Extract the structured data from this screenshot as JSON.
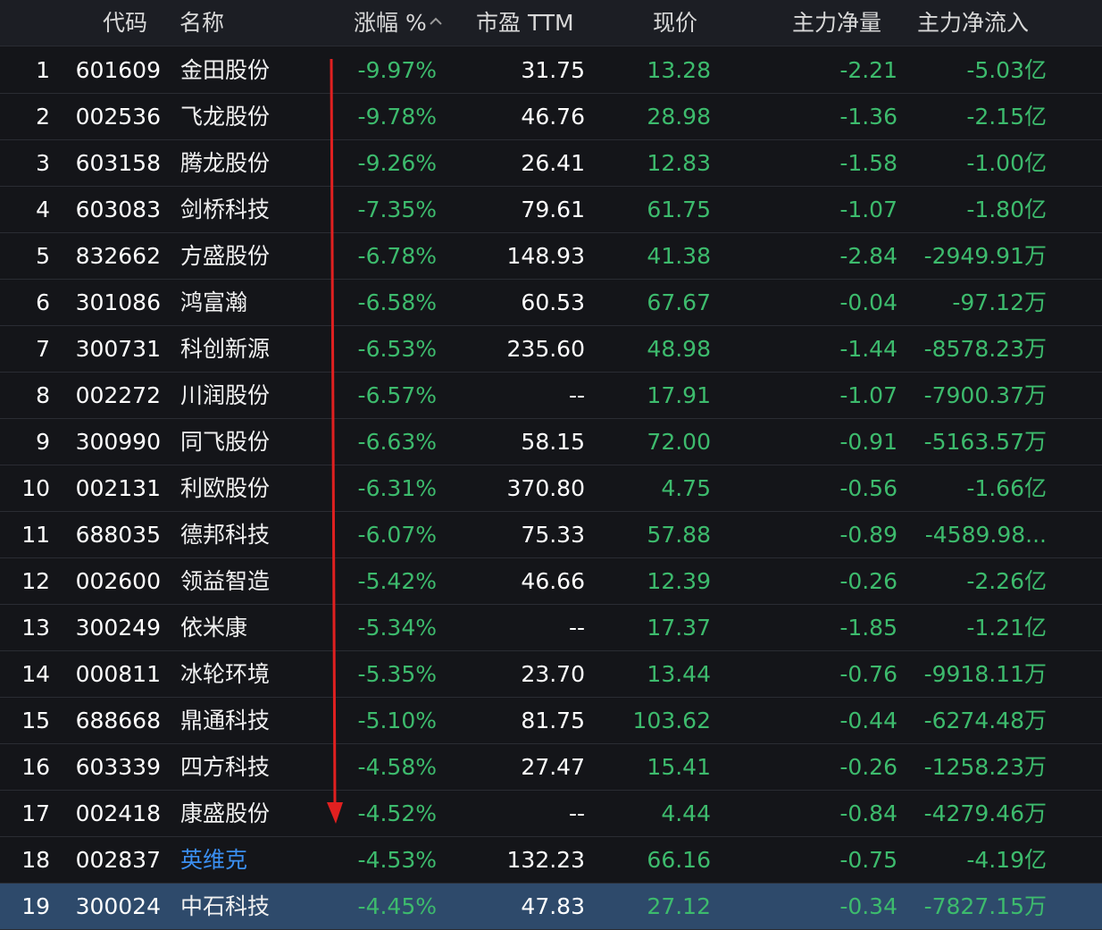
{
  "header": {
    "code": "代码",
    "name": "名称",
    "change": "涨幅 %",
    "pe": "市盈 TTM",
    "price": "现价",
    "main_net_volume": "主力净量",
    "main_net_inflow": "主力净流入"
  },
  "colors": {
    "background": "#141519",
    "header_bg": "#1c1e24",
    "down_green": "#3dbb6d",
    "link_blue": "#3a8ef0",
    "selected_row": "#2e4a6b",
    "arrow_red": "#e02020"
  },
  "rows": [
    {
      "idx": "1",
      "code": "601609",
      "name": "金田股份",
      "change": "-9.97%",
      "pe": "31.75",
      "price": "13.28",
      "vol": "-2.21",
      "inflow": "-5.03亿"
    },
    {
      "idx": "2",
      "code": "002536",
      "name": "飞龙股份",
      "change": "-9.78%",
      "pe": "46.76",
      "price": "28.98",
      "vol": "-1.36",
      "inflow": "-2.15亿"
    },
    {
      "idx": "3",
      "code": "603158",
      "name": "腾龙股份",
      "change": "-9.26%",
      "pe": "26.41",
      "price": "12.83",
      "vol": "-1.58",
      "inflow": "-1.00亿"
    },
    {
      "idx": "4",
      "code": "603083",
      "name": "剑桥科技",
      "change": "-7.35%",
      "pe": "79.61",
      "price": "61.75",
      "vol": "-1.07",
      "inflow": "-1.80亿"
    },
    {
      "idx": "5",
      "code": "832662",
      "name": "方盛股份",
      "change": "-6.78%",
      "pe": "148.93",
      "price": "41.38",
      "vol": "-2.84",
      "inflow": "-2949.91万"
    },
    {
      "idx": "6",
      "code": "301086",
      "name": "鸿富瀚",
      "change": "-6.58%",
      "pe": "60.53",
      "price": "67.67",
      "vol": "-0.04",
      "inflow": "-97.12万"
    },
    {
      "idx": "7",
      "code": "300731",
      "name": "科创新源",
      "change": "-6.53%",
      "pe": "235.60",
      "price": "48.98",
      "vol": "-1.44",
      "inflow": "-8578.23万"
    },
    {
      "idx": "8",
      "code": "002272",
      "name": "川润股份",
      "change": "-6.57%",
      "pe": "--",
      "price": "17.91",
      "vol": "-1.07",
      "inflow": "-7900.37万"
    },
    {
      "idx": "9",
      "code": "300990",
      "name": "同飞股份",
      "change": "-6.63%",
      "pe": "58.15",
      "price": "72.00",
      "vol": "-0.91",
      "inflow": "-5163.57万"
    },
    {
      "idx": "10",
      "code": "002131",
      "name": "利欧股份",
      "change": "-6.31%",
      "pe": "370.80",
      "price": "4.75",
      "vol": "-0.56",
      "inflow": "-1.66亿"
    },
    {
      "idx": "11",
      "code": "688035",
      "name": "德邦科技",
      "change": "-6.07%",
      "pe": "75.33",
      "price": "57.88",
      "vol": "-0.89",
      "inflow": "-4589.98..."
    },
    {
      "idx": "12",
      "code": "002600",
      "name": "领益智造",
      "change": "-5.42%",
      "pe": "46.66",
      "price": "12.39",
      "vol": "-0.26",
      "inflow": "-2.26亿"
    },
    {
      "idx": "13",
      "code": "300249",
      "name": "依米康",
      "change": "-5.34%",
      "pe": "--",
      "price": "17.37",
      "vol": "-1.85",
      "inflow": "-1.21亿"
    },
    {
      "idx": "14",
      "code": "000811",
      "name": "冰轮环境",
      "change": "-5.35%",
      "pe": "23.70",
      "price": "13.44",
      "vol": "-0.76",
      "inflow": "-9918.11万"
    },
    {
      "idx": "15",
      "code": "688668",
      "name": "鼎通科技",
      "change": "-5.10%",
      "pe": "81.75",
      "price": "103.62",
      "vol": "-0.44",
      "inflow": "-6274.48万"
    },
    {
      "idx": "16",
      "code": "603339",
      "name": "四方科技",
      "change": "-4.58%",
      "pe": "27.47",
      "price": "15.41",
      "vol": "-0.26",
      "inflow": "-1258.23万"
    },
    {
      "idx": "17",
      "code": "002418",
      "name": "康盛股份",
      "change": "-4.52%",
      "pe": "--",
      "price": "4.44",
      "vol": "-0.84",
      "inflow": "-4279.46万"
    },
    {
      "idx": "18",
      "code": "002837",
      "name": "英维克",
      "change": "-4.53%",
      "pe": "132.23",
      "price": "66.16",
      "vol": "-0.75",
      "inflow": "-4.19亿"
    },
    {
      "idx": "19",
      "code": "300024",
      "name": "中石科技",
      "change": "-4.45%",
      "pe": "47.83",
      "price": "27.12",
      "vol": "-0.34",
      "inflow": "-7827.15万"
    }
  ]
}
